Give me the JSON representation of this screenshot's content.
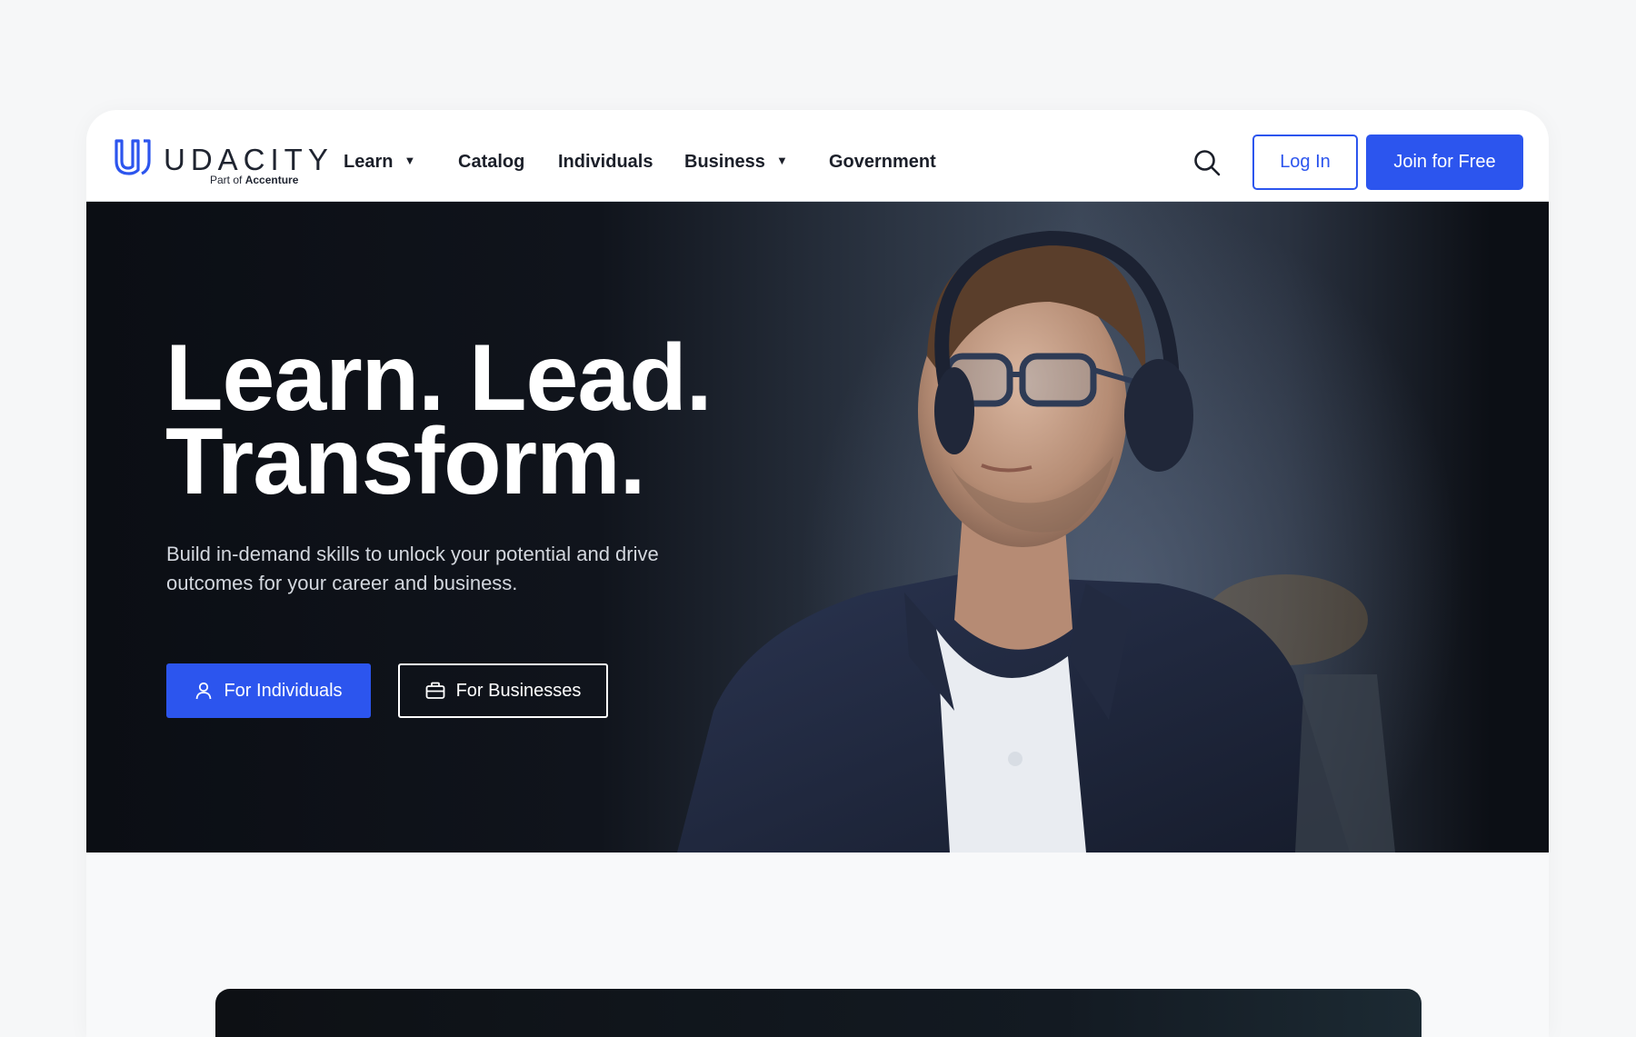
{
  "brand": {
    "name": "UDACITY",
    "sub_prefix": "Part of",
    "sub_company": "Accenture",
    "color": "#2c55ee"
  },
  "nav": {
    "items": [
      {
        "label": "Learn",
        "dropdown": true
      },
      {
        "label": "Catalog",
        "dropdown": false
      },
      {
        "label": "Individuals",
        "dropdown": false
      },
      {
        "label": "Business",
        "dropdown": true
      },
      {
        "label": "Government",
        "dropdown": false
      }
    ],
    "caret": "▼",
    "search_icon": "search-icon",
    "login_label": "Log In",
    "join_label": "Join for Free"
  },
  "hero": {
    "title_line1": "Learn. Lead.",
    "title_line2": "Transform.",
    "subtitle": "Build in-demand skills to unlock your potential and drive outcomes for your career and business.",
    "cta_individuals": "For Individuals",
    "cta_businesses": "For Businesses",
    "cta_individuals_icon": "user-icon",
    "cta_businesses_icon": "briefcase-icon"
  },
  "colors": {
    "accent": "#2c55ee",
    "hero_bg": "#0b0e14",
    "text_dark": "#1b1f29"
  }
}
